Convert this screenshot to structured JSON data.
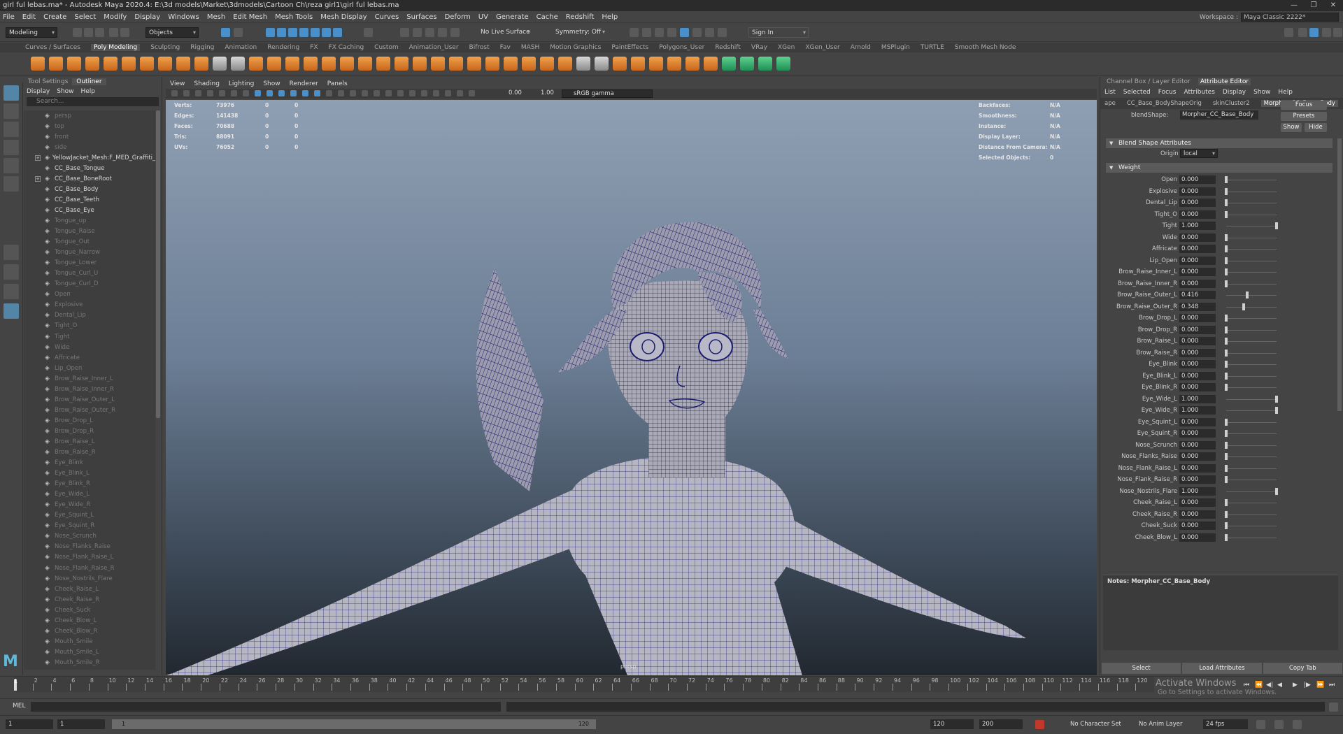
{
  "window": {
    "title": "girl ful lebas.ma* - Autodesk Maya 2020.4: E:\\3d models\\Market\\3dmodels\\Cartoon Ch\\reza girl1\\girl ful lebas.ma"
  },
  "menus": [
    "File",
    "Edit",
    "Create",
    "Select",
    "Modify",
    "Display",
    "Windows",
    "Mesh",
    "Edit Mesh",
    "Mesh Tools",
    "Mesh Display",
    "Curves",
    "Surfaces",
    "Deform",
    "UV",
    "Generate",
    "Cache",
    "Redshift",
    "Help"
  ],
  "workspace": {
    "label": "Workspace :",
    "value": "Maya Classic 2222*"
  },
  "statusline": {
    "mode": "Modeling",
    "objects": "Objects",
    "live_surface": "No Live Surface",
    "symmetry": "Symmetry: Off",
    "sign_in": "Sign In"
  },
  "shelf_tabs": [
    "Curves / Surfaces",
    "Poly Modeling",
    "Sculpting",
    "Rigging",
    "Animation",
    "Rendering",
    "FX",
    "FX Caching",
    "Custom",
    "Animation_User",
    "Bifrost",
    "Fav",
    "MASH",
    "Motion Graphics",
    "PaintEffects",
    "Polygons_User",
    "Redshift",
    "VRay",
    "XGen",
    "XGen_User",
    "Arnold",
    "MSPlugin",
    "TURTLE",
    "Smooth Mesh Node"
  ],
  "outliner": {
    "tabs": [
      "Tool Settings",
      "Outliner"
    ],
    "menu": [
      "Display",
      "Show",
      "Help"
    ],
    "search_placeholder": "Search...",
    "items": [
      "persp",
      "top",
      "front",
      "side",
      "YellowJacket_Mesh:F_MED_Graffiti_As",
      "CC_Base_Tongue",
      "CC_Base_BoneRoot",
      "CC_Base_Body",
      "CC_Base_Teeth",
      "CC_Base_Eye",
      "Tongue_up",
      "Tongue_Raise",
      "Tongue_Out",
      "Tongue_Narrow",
      "Tongue_Lower",
      "Tongue_Curl_U",
      "Tongue_Curl_D",
      "Open",
      "Explosive",
      "Dental_Lip",
      "Tight_O",
      "Tight",
      "Wide",
      "Affricate",
      "Lip_Open",
      "Brow_Raise_Inner_L",
      "Brow_Raise_Inner_R",
      "Brow_Raise_Outer_L",
      "Brow_Raise_Outer_R",
      "Brow_Drop_L",
      "Brow_Drop_R",
      "Brow_Raise_L",
      "Brow_Raise_R",
      "Eye_Blink",
      "Eye_Blink_L",
      "Eye_Blink_R",
      "Eye_Wide_L",
      "Eye_Wide_R",
      "Eye_Squint_L",
      "Eye_Squint_R",
      "Nose_Scrunch",
      "Nose_Flanks_Raise",
      "Nose_Flank_Raise_L",
      "Nose_Flank_Raise_R",
      "Nose_Nostrils_Flare",
      "Cheek_Raise_L",
      "Cheek_Raise_R",
      "Cheek_Suck",
      "Cheek_Blow_L",
      "Cheek_Blow_R",
      "Mouth_Smile",
      "Mouth_Smile_L",
      "Mouth_Smile_R"
    ]
  },
  "viewport": {
    "menu": [
      "View",
      "Shading",
      "Lighting",
      "Show",
      "Renderer",
      "Panels"
    ],
    "exposure": "0.00",
    "gamma": "1.00",
    "color_space": "sRGB gamma",
    "hud_left": {
      "labels": [
        "Verts:",
        "Edges:",
        "Faces:",
        "Tris:",
        "UVs:"
      ],
      "values": [
        "73976",
        "141438",
        "70688",
        "88091",
        "76052"
      ],
      "c2": [
        "0",
        "0",
        "0",
        "0",
        "0"
      ],
      "c3": [
        "0",
        "0",
        "0",
        "0",
        "0"
      ]
    },
    "hud_right": {
      "labels": [
        "Backfaces:",
        "Smoothness:",
        "Instance:",
        "Display Layer:",
        "Distance From Camera:",
        "Selected Objects:"
      ],
      "values": [
        "N/A",
        "N/A",
        "N/A",
        "N/A",
        "N/A",
        "0"
      ]
    },
    "camera": "persp"
  },
  "attr_editor": {
    "tabs": [
      "Channel Box / Layer Editor",
      "Attribute Editor"
    ],
    "menu": [
      "List",
      "Selected",
      "Focus",
      "Attributes",
      "Display",
      "Show",
      "Help"
    ],
    "node_tabs": [
      "ape",
      "CC_Base_BodyShapeOrig",
      "skinCluster2",
      "Morpher_CC_Base_Body"
    ],
    "blendshape_label": "blendShape:",
    "blendshape_value": "Morpher_CC_Base_Body",
    "buttons": {
      "focus": "Focus",
      "presets": "Presets",
      "show": "Show",
      "hide": "Hide"
    },
    "section1": "Blend Shape Attributes",
    "origin_label": "Origin",
    "origin_value": "local",
    "section2": "Weight",
    "weights": [
      [
        "Open",
        "0.000"
      ],
      [
        "Explosive",
        "0.000"
      ],
      [
        "Dental_Lip",
        "0.000"
      ],
      [
        "Tight_O",
        "0.000"
      ],
      [
        "Tight",
        "1.000"
      ],
      [
        "Wide",
        "0.000"
      ],
      [
        "Affricate",
        "0.000"
      ],
      [
        "Lip_Open",
        "0.000"
      ],
      [
        "Brow_Raise_Inner_L",
        "0.000"
      ],
      [
        "Brow_Raise_Inner_R",
        "0.000"
      ],
      [
        "Brow_Raise_Outer_L",
        "0.416"
      ],
      [
        "Brow_Raise_Outer_R",
        "0.348"
      ],
      [
        "Brow_Drop_L",
        "0.000"
      ],
      [
        "Brow_Drop_R",
        "0.000"
      ],
      [
        "Brow_Raise_L",
        "0.000"
      ],
      [
        "Brow_Raise_R",
        "0.000"
      ],
      [
        "Eye_Blink",
        "0.000"
      ],
      [
        "Eye_Blink_L",
        "0.000"
      ],
      [
        "Eye_Blink_R",
        "0.000"
      ],
      [
        "Eye_Wide_L",
        "1.000"
      ],
      [
        "Eye_Wide_R",
        "1.000"
      ],
      [
        "Eye_Squint_L",
        "0.000"
      ],
      [
        "Eye_Squint_R",
        "0.000"
      ],
      [
        "Nose_Scrunch",
        "0.000"
      ],
      [
        "Nose_Flanks_Raise",
        "0.000"
      ],
      [
        "Nose_Flank_Raise_L",
        "0.000"
      ],
      [
        "Nose_Flank_Raise_R",
        "0.000"
      ],
      [
        "Nose_Nostrils_Flare",
        "1.000"
      ],
      [
        "Cheek_Raise_L",
        "0.000"
      ],
      [
        "Cheek_Raise_R",
        "0.000"
      ],
      [
        "Cheek_Suck",
        "0.000"
      ],
      [
        "Cheek_Blow_L",
        "0.000"
      ]
    ],
    "notes": "Notes:  Morpher_CC_Base_Body",
    "bottom": [
      "Select",
      "Load Attributes",
      "Copy Tab"
    ]
  },
  "timeline": {
    "ticks": [
      "2",
      "4",
      "6",
      "8",
      "10",
      "12",
      "14",
      "16",
      "18",
      "20",
      "22",
      "24",
      "26",
      "28",
      "30",
      "32",
      "34",
      "36",
      "38",
      "40",
      "42",
      "44",
      "46",
      "48",
      "50",
      "52",
      "54",
      "56",
      "58",
      "60",
      "62",
      "64",
      "66",
      "68",
      "70",
      "72",
      "74",
      "76",
      "78",
      "80",
      "82",
      "84",
      "86",
      "88",
      "90",
      "92",
      "94",
      "96",
      "98",
      "100",
      "102",
      "104",
      "106",
      "108",
      "110",
      "112",
      "114",
      "116",
      "118",
      "120"
    ],
    "current": "1",
    "watermark1": "Activate Windows",
    "watermark2": "Go to Settings to activate Windows."
  },
  "cmdline": {
    "label": "MEL"
  },
  "range": {
    "start": "1",
    "playback_start": "1",
    "slider_start": "1",
    "slider_end": "120",
    "playback_end": "120",
    "end": "200",
    "char_set": "No Character Set",
    "anim_layer": "No Anim Layer",
    "fps": "24 fps"
  },
  "colors": {
    "accent": "#4b8fc9",
    "shelf_orange": "#e08a33",
    "wire": "#1f1f7a",
    "mesh": "#b9b9c2"
  }
}
